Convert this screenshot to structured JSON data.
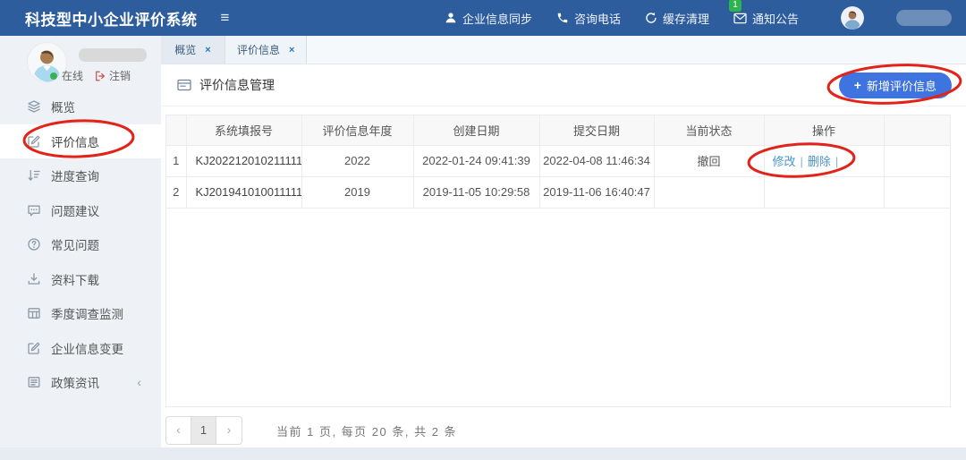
{
  "header": {
    "title": "科技型中小企业评价系统",
    "nav": [
      {
        "label": "企业信息同步",
        "icon": "user-icon"
      },
      {
        "label": "咨询电话",
        "icon": "phone-icon"
      },
      {
        "label": "缓存清理",
        "icon": "refresh-icon"
      },
      {
        "label": "通知公告",
        "icon": "mail-icon",
        "badge": "1"
      }
    ]
  },
  "user_panel": {
    "online_label": "在线",
    "logout_label": "注销"
  },
  "sidebar": {
    "items": [
      {
        "label": "概览",
        "icon": "layers-icon"
      },
      {
        "label": "评价信息",
        "icon": "edit-square-icon",
        "active": true
      },
      {
        "label": "进度查询",
        "icon": "sort-icon"
      },
      {
        "label": "问题建议",
        "icon": "comment-icon"
      },
      {
        "label": "常见问题",
        "icon": "question-icon"
      },
      {
        "label": "资料下载",
        "icon": "download-icon"
      },
      {
        "label": "季度调查监测",
        "icon": "grid-icon"
      },
      {
        "label": "企业信息变更",
        "icon": "edit-square-icon"
      },
      {
        "label": "政策资讯",
        "icon": "news-icon",
        "collapsed": true
      }
    ]
  },
  "tabs": [
    {
      "label": "概览",
      "close": "×"
    },
    {
      "label": "评价信息",
      "close": "×",
      "active": true
    }
  ],
  "main": {
    "page_title": "评价信息管理",
    "add_button_label": "新增评价信息",
    "add_button_plus": "+",
    "table": {
      "columns": [
        "",
        "系统填报号",
        "评价信息年度",
        "创建日期",
        "提交日期",
        "当前状态",
        "操作",
        ""
      ],
      "rows": [
        {
          "index": "1",
          "report_no": "KJ202212010211111...",
          "year": "2022",
          "created": "2022-01-24 09:41:39",
          "submitted": "2022-04-08 11:46:34",
          "status": "撤回",
          "action_edit": "修改",
          "action_delete": "删除",
          "separator": "|"
        },
        {
          "index": "2",
          "report_no": "KJ201941010011111...",
          "year": "2019",
          "created": "2019-11-05 10:29:58",
          "submitted": "2019-11-06 16:40:47",
          "status": "",
          "action_edit": "",
          "action_delete": "",
          "separator": ""
        }
      ]
    },
    "pagination": {
      "prev_label": "‹",
      "page": "1",
      "next_label": "›",
      "info": "当前 1 页, 每页 20 条, 共 2 条"
    }
  },
  "colors": {
    "header_bg": "#2e5d9d",
    "button_blue": "#3e73e0",
    "link_blue": "#4a90d2",
    "badge_green": "#2db44d",
    "online_green": "#3cb153",
    "annotation_red": "#e2231a"
  }
}
